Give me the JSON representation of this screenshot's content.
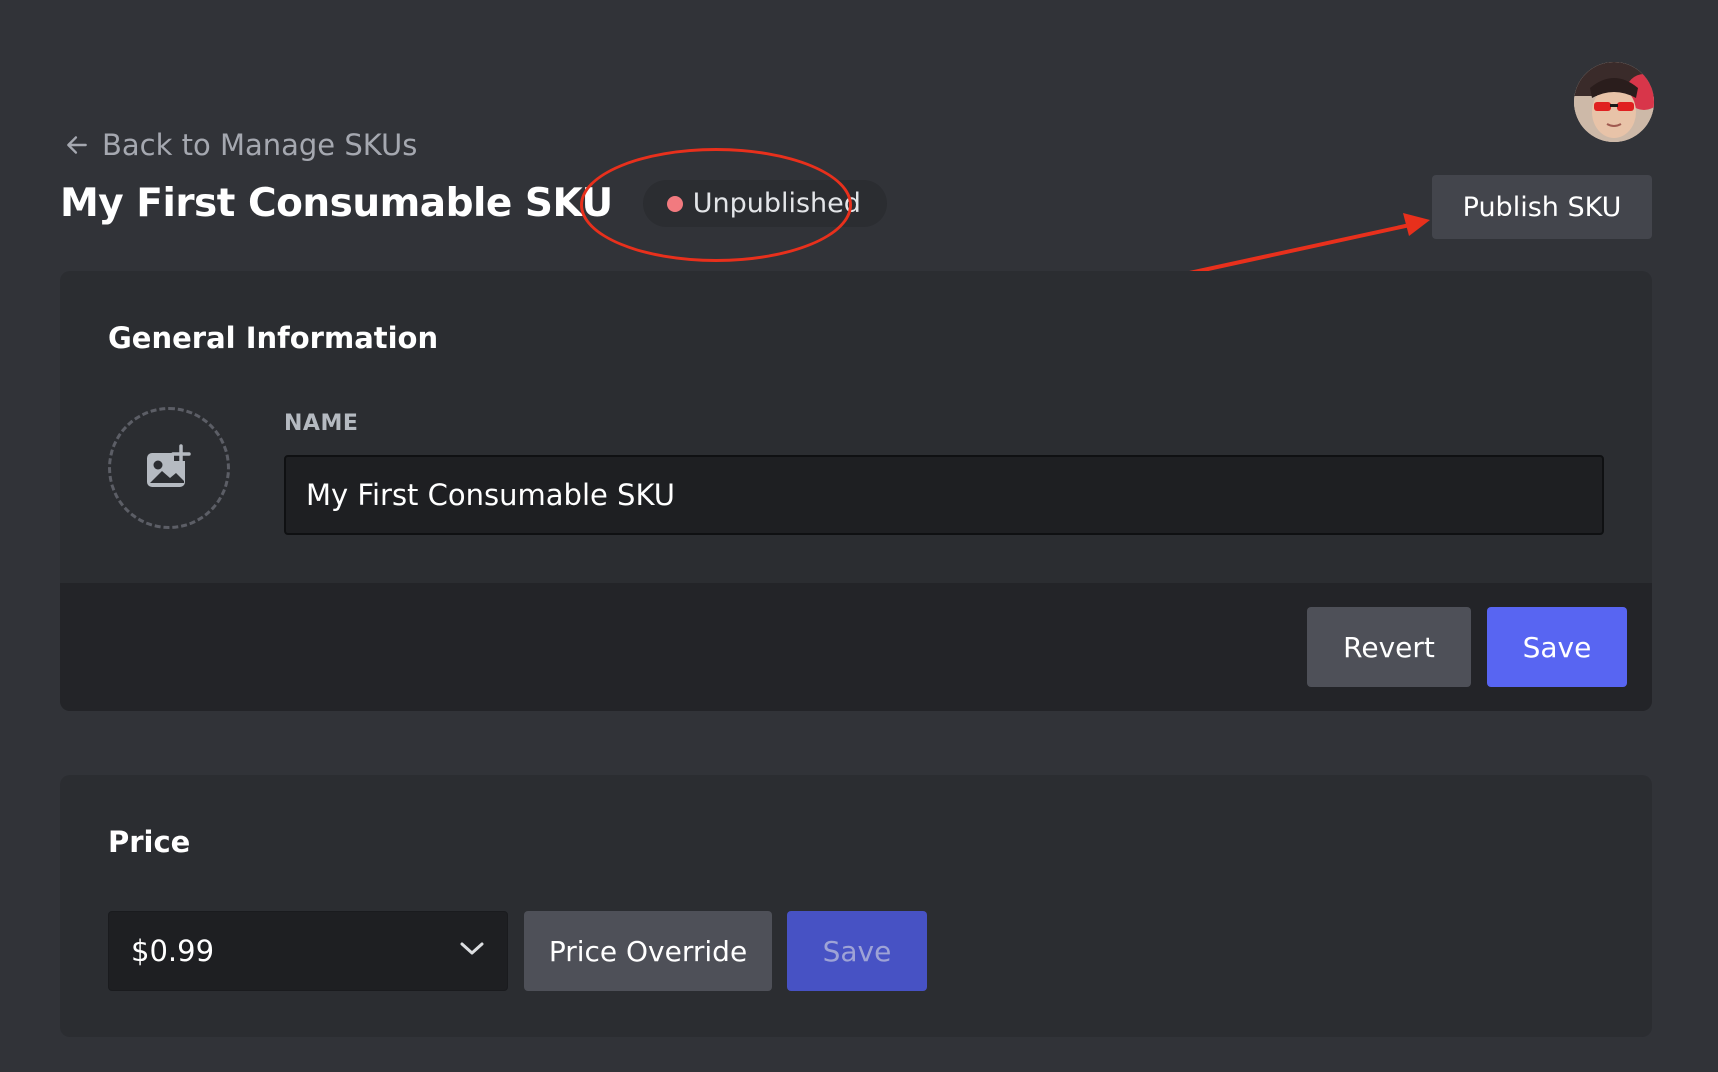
{
  "header": {
    "back_label": "Back to Manage SKUs",
    "title": "My First Consumable SKU",
    "status": "Unpublished",
    "publish_label": "Publish SKU"
  },
  "general": {
    "section_title": "General Information",
    "name_label": "NAME",
    "name_value": "My First Consumable SKU",
    "revert_label": "Revert",
    "save_label": "Save"
  },
  "price": {
    "section_title": "Price",
    "selected_price": "$0.99",
    "override_label": "Price Override",
    "save_label": "Save"
  },
  "colors": {
    "background": "#313338",
    "card": "#2b2d31",
    "accent": "#5865f2",
    "status_dot": "#f27a7f",
    "annotation": "#e8301c"
  },
  "icons": {
    "back": "arrow-left-icon",
    "image_upload": "image-add-icon",
    "dropdown": "chevron-down-icon"
  }
}
